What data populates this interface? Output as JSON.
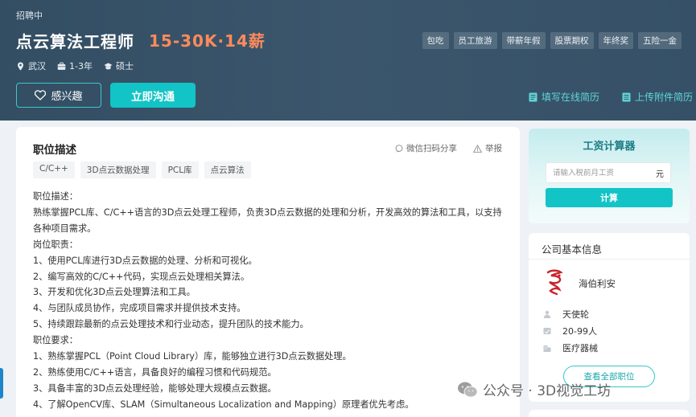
{
  "job": {
    "status": "招聘中",
    "title": "点云算法工程师",
    "salary": "15-30K·14薪",
    "location": "武汉",
    "experience": "1-3年",
    "education": "硕士",
    "benefits": [
      "包吃",
      "员工旅游",
      "带薪年假",
      "股票期权",
      "年终奖",
      "五险一金"
    ],
    "interest_label": "感兴趣",
    "chat_label": "立即沟通",
    "fill_resume_label": "填写在线简历",
    "upload_resume_label": "上传附件简历"
  },
  "description": {
    "section_title": "职位描述",
    "share_label": "微信扫码分享",
    "report_label": "举报",
    "skills": [
      "C/C++",
      "3D点云数据处理",
      "PCL库",
      "点云算法"
    ],
    "lines": [
      "职位描述：",
      "熟练掌握PCL库、C/C++语言的3D点云处理工程师，负责3D点云数据的处理和分析，开发高效的算法和工具，以支持各种项目需求。",
      "岗位职责：",
      "1、使用PCL库进行3D点云数据的处理、分析和可视化。",
      "2、编写高效的C/C++代码，实现点云处理相关算法。",
      "3、开发和优化3D点云处理算法和工具。",
      "4、与团队成员协作，完成项目需求并提供技术支持。",
      "5、持续跟踪最新的点云处理技术和行业动态，提升团队的技术能力。",
      "职位要求：",
      "1、熟练掌握PCL（Point Cloud Library）库，能够独立进行3D点云数据处理。",
      "2、熟练使用C/C++语言，具备良好的编程习惯和代码规范。",
      "3、具备丰富的3D点云处理经验，能够处理大规模点云数据。",
      "4、了解OpenCV库、SLAM（Simultaneous Localization and Mapping）原理者优先考虑。"
    ]
  },
  "calculator": {
    "title": "工资计算器",
    "input_placeholder": "请输入税前月工资",
    "unit": "元",
    "button_label": "计算"
  },
  "company": {
    "section_title": "公司基本信息",
    "name": "海伯利安",
    "funding": "天使轮",
    "size": "20-99人",
    "industry": "医疗器械",
    "view_jobs_label": "查看全部职位"
  },
  "watermark": {
    "text": "公众号 · 3D视觉工坊"
  },
  "colors": {
    "header_bg": "#3b566c",
    "accent": "#12c4c6",
    "salary": "#ff8a5c"
  }
}
